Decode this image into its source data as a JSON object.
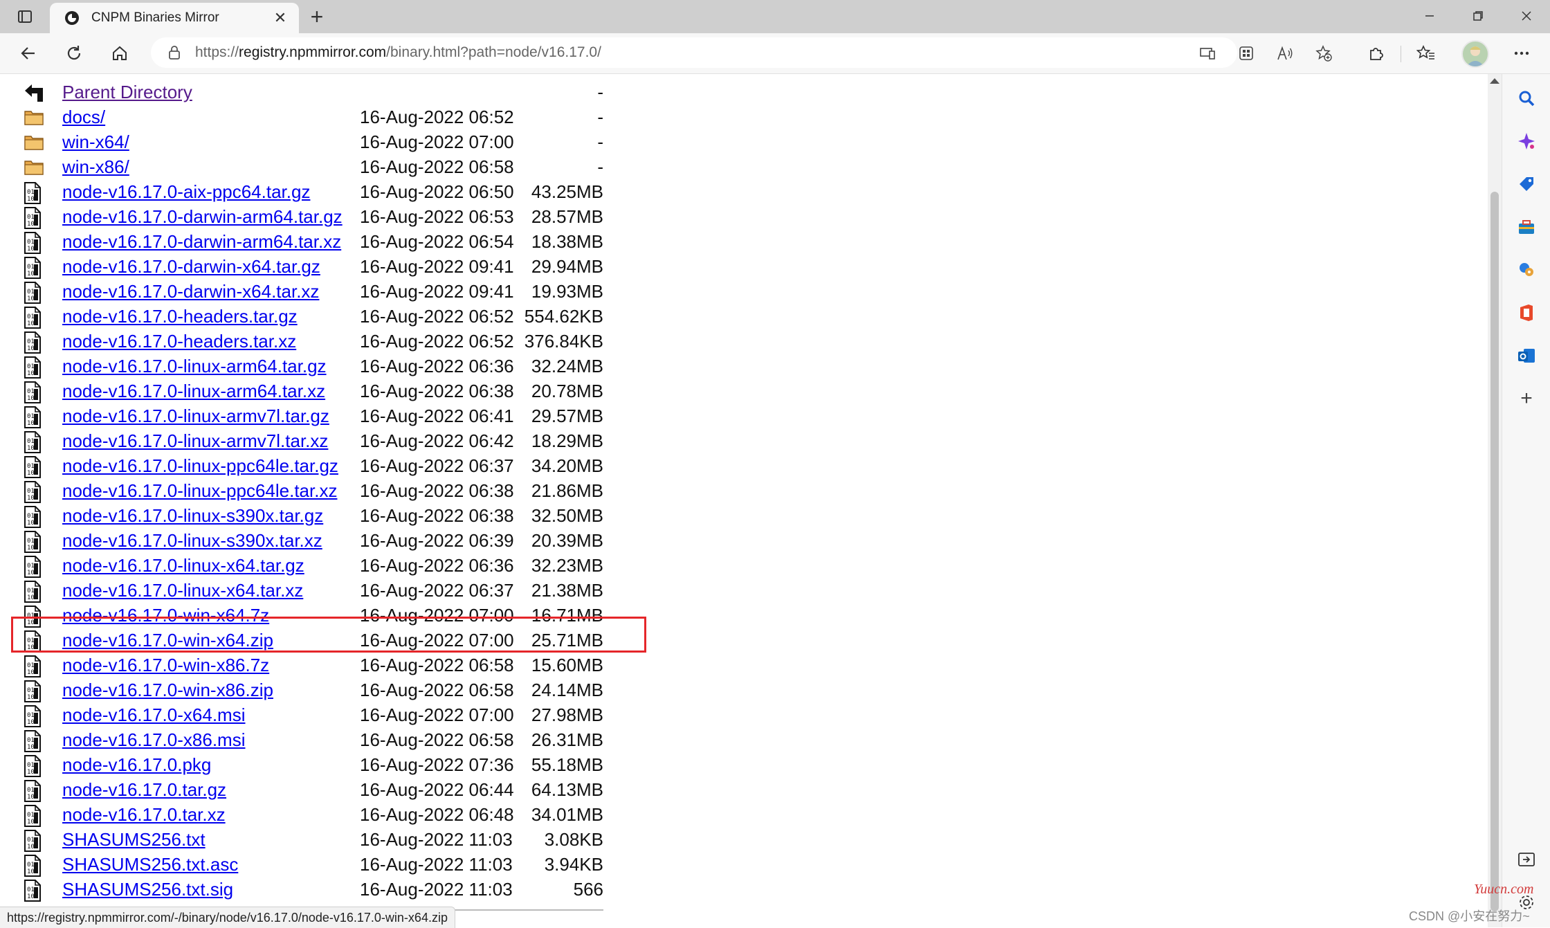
{
  "browser": {
    "tab_title": "CNPM Binaries Mirror",
    "url_scheme": "https://",
    "url_domain": "registry.npmmirror.com",
    "url_path": "/binary.html?path=node/v16.17.0/",
    "status_url": "https://registry.npmmirror.com/-/binary/node/v16.17.0/node-v16.17.0-win-x64.zip",
    "icons": {
      "tab_actions": "tab-actions-icon",
      "favicon": "cnpm-favicon",
      "back": "back-arrow-icon",
      "reload": "reload-icon",
      "home": "home-icon",
      "lock": "lock-icon",
      "extensions": "puzzle-icon",
      "favorites": "favorites-icon",
      "more": "more-icon"
    }
  },
  "listing": [
    {
      "name": "Parent Directory",
      "date": "",
      "size": "-",
      "type": "parent"
    },
    {
      "name": "docs/",
      "date": "16-Aug-2022 06:52",
      "size": "-",
      "type": "folder"
    },
    {
      "name": "win-x64/",
      "date": "16-Aug-2022 07:00",
      "size": "-",
      "type": "folder"
    },
    {
      "name": "win-x86/",
      "date": "16-Aug-2022 06:58",
      "size": "-",
      "type": "folder"
    },
    {
      "name": "node-v16.17.0-aix-ppc64.tar.gz",
      "date": "16-Aug-2022 06:50",
      "size": "43.25MB",
      "type": "file"
    },
    {
      "name": "node-v16.17.0-darwin-arm64.tar.gz",
      "date": "16-Aug-2022 06:53",
      "size": "28.57MB",
      "type": "file"
    },
    {
      "name": "node-v16.17.0-darwin-arm64.tar.xz",
      "date": "16-Aug-2022 06:54",
      "size": "18.38MB",
      "type": "file"
    },
    {
      "name": "node-v16.17.0-darwin-x64.tar.gz",
      "date": "16-Aug-2022 09:41",
      "size": "29.94MB",
      "type": "file"
    },
    {
      "name": "node-v16.17.0-darwin-x64.tar.xz",
      "date": "16-Aug-2022 09:41",
      "size": "19.93MB",
      "type": "file"
    },
    {
      "name": "node-v16.17.0-headers.tar.gz",
      "date": "16-Aug-2022 06:52",
      "size": "554.62KB",
      "type": "file"
    },
    {
      "name": "node-v16.17.0-headers.tar.xz",
      "date": "16-Aug-2022 06:52",
      "size": "376.84KB",
      "type": "file"
    },
    {
      "name": "node-v16.17.0-linux-arm64.tar.gz",
      "date": "16-Aug-2022 06:36",
      "size": "32.24MB",
      "type": "file"
    },
    {
      "name": "node-v16.17.0-linux-arm64.tar.xz",
      "date": "16-Aug-2022 06:38",
      "size": "20.78MB",
      "type": "file"
    },
    {
      "name": "node-v16.17.0-linux-armv7l.tar.gz",
      "date": "16-Aug-2022 06:41",
      "size": "29.57MB",
      "type": "file"
    },
    {
      "name": "node-v16.17.0-linux-armv7l.tar.xz",
      "date": "16-Aug-2022 06:42",
      "size": "18.29MB",
      "type": "file"
    },
    {
      "name": "node-v16.17.0-linux-ppc64le.tar.gz",
      "date": "16-Aug-2022 06:37",
      "size": "34.20MB",
      "type": "file"
    },
    {
      "name": "node-v16.17.0-linux-ppc64le.tar.xz",
      "date": "16-Aug-2022 06:38",
      "size": "21.86MB",
      "type": "file"
    },
    {
      "name": "node-v16.17.0-linux-s390x.tar.gz",
      "date": "16-Aug-2022 06:38",
      "size": "32.50MB",
      "type": "file"
    },
    {
      "name": "node-v16.17.0-linux-s390x.tar.xz",
      "date": "16-Aug-2022 06:39",
      "size": "20.39MB",
      "type": "file"
    },
    {
      "name": "node-v16.17.0-linux-x64.tar.gz",
      "date": "16-Aug-2022 06:36",
      "size": "32.23MB",
      "type": "file"
    },
    {
      "name": "node-v16.17.0-linux-x64.tar.xz",
      "date": "16-Aug-2022 06:37",
      "size": "21.38MB",
      "type": "file"
    },
    {
      "name": "node-v16.17.0-win-x64.7z",
      "date": "16-Aug-2022 07:00",
      "size": "16.71MB",
      "type": "file"
    },
    {
      "name": "node-v16.17.0-win-x64.zip",
      "date": "16-Aug-2022 07:00",
      "size": "25.71MB",
      "type": "file",
      "highlighted": true
    },
    {
      "name": "node-v16.17.0-win-x86.7z",
      "date": "16-Aug-2022 06:58",
      "size": "15.60MB",
      "type": "file"
    },
    {
      "name": "node-v16.17.0-win-x86.zip",
      "date": "16-Aug-2022 06:58",
      "size": "24.14MB",
      "type": "file"
    },
    {
      "name": "node-v16.17.0-x64.msi",
      "date": "16-Aug-2022 07:00",
      "size": "27.98MB",
      "type": "file"
    },
    {
      "name": "node-v16.17.0-x86.msi",
      "date": "16-Aug-2022 06:58",
      "size": "26.31MB",
      "type": "file"
    },
    {
      "name": "node-v16.17.0.pkg",
      "date": "16-Aug-2022 07:36",
      "size": "55.18MB",
      "type": "file"
    },
    {
      "name": "node-v16.17.0.tar.gz",
      "date": "16-Aug-2022 06:44",
      "size": "64.13MB",
      "type": "file"
    },
    {
      "name": "node-v16.17.0.tar.xz",
      "date": "16-Aug-2022 06:48",
      "size": "34.01MB",
      "type": "file"
    },
    {
      "name": "SHASUMS256.txt",
      "date": "16-Aug-2022 11:03",
      "size": "3.08KB",
      "type": "file"
    },
    {
      "name": "SHASUMS256.txt.asc",
      "date": "16-Aug-2022 11:03",
      "size": "3.94KB",
      "type": "file"
    },
    {
      "name": "SHASUMS256.txt.sig",
      "date": "16-Aug-2022 11:03",
      "size": "566",
      "type": "file"
    }
  ],
  "colors": {
    "link": "#0000ee",
    "visited": "#551a8b",
    "highlight_border": "#e5262a"
  },
  "watermarks": {
    "site": "Yuucn.com",
    "author": "CSDN @小安在努力~"
  }
}
